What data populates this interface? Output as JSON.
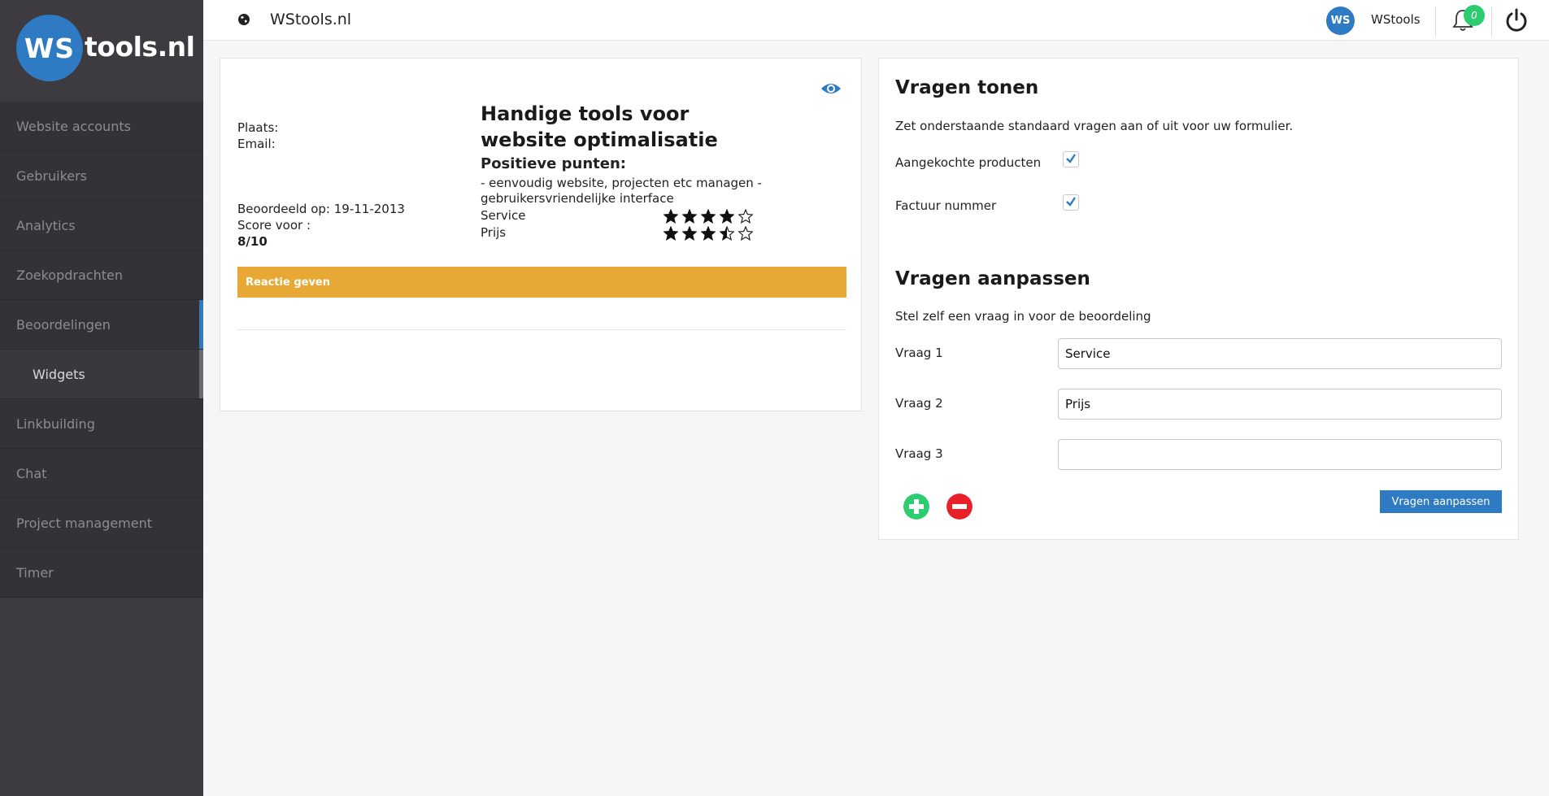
{
  "sidebar": {
    "logo_initials": "WS",
    "logo_text": "tools.nl",
    "items": [
      {
        "label": "Website accounts"
      },
      {
        "label": "Gebruikers"
      },
      {
        "label": "Analytics"
      },
      {
        "label": "Zoekopdrachten"
      },
      {
        "label": "Beoordelingen"
      },
      {
        "label": "Widgets"
      },
      {
        "label": "Linkbuilding"
      },
      {
        "label": "Chat"
      },
      {
        "label": "Project management"
      },
      {
        "label": "Timer"
      }
    ]
  },
  "header": {
    "site_title": "WStools.nl",
    "user_initials": "WS",
    "user_name": "WStools",
    "notification_count": "0"
  },
  "review": {
    "place_label": "Plaats:",
    "email_label": "Email:",
    "rated_on": "Beoordeeld op: 19-11-2013",
    "score_label": "Score voor :",
    "score_value": "8/10",
    "title": "Handige tools voor website optimalisatie",
    "positive_title": "Positieve punten:",
    "positive_text": "- eenvoudig website, projecten etc managen - gebruikersvriendelijke interface",
    "ratings": [
      {
        "label": "Service",
        "stars": 4
      },
      {
        "label": "Prijs",
        "stars": 3.5
      }
    ],
    "reply_label": "Reactie geven"
  },
  "questions": {
    "show_title": "Vragen tonen",
    "show_desc": "Zet onderstaande standaard vragen aan of uit voor uw formulier.",
    "toggles": [
      {
        "label": "Aangekochte producten",
        "checked": true
      },
      {
        "label": "Factuur nummer",
        "checked": true
      }
    ],
    "edit_title": "Vragen aanpassen",
    "edit_desc": "Stel zelf een vraag in voor de beoordeling",
    "fields": [
      {
        "label": "Vraag 1",
        "value": "Service"
      },
      {
        "label": "Vraag 2",
        "value": "Prijs"
      },
      {
        "label": "Vraag 3",
        "value": ""
      }
    ],
    "submit_label": "Vragen aanpassen"
  },
  "colors": {
    "brand": "#2e7bc4",
    "reply_bar": "#e8a835",
    "add": "#2ecc71",
    "remove": "#e8202a"
  }
}
